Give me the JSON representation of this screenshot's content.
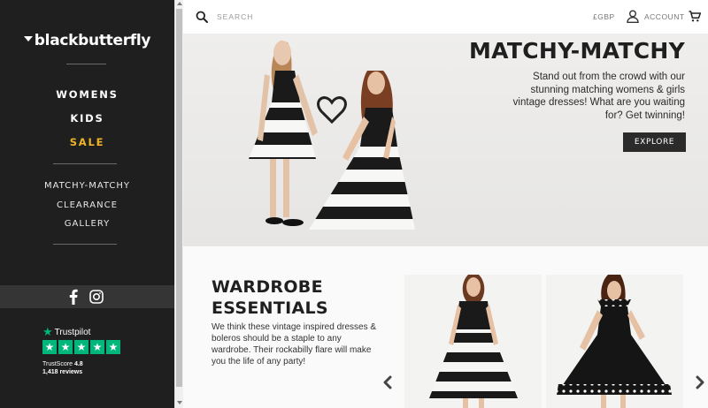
{
  "sidebar": {
    "logo": "blackbutterfly",
    "main_nav": [
      {
        "label": "WOMENS"
      },
      {
        "label": "KIDS"
      },
      {
        "label": "SALE"
      }
    ],
    "sub_nav": [
      {
        "label": "MATCHY-MATCHY"
      },
      {
        "label": "CLEARANCE"
      },
      {
        "label": "GALLERY"
      }
    ],
    "social": [
      "facebook-icon",
      "instagram-icon"
    ],
    "trustpilot": {
      "brand": "Trustpilot",
      "stars": 5,
      "score_label": "TrustScore",
      "score": "4.8",
      "reviews": "1,418 reviews"
    }
  },
  "header": {
    "search_placeholder": "SEARCH",
    "currency": "£GBP",
    "account_label": "ACCOUNT"
  },
  "hero": {
    "title": "MATCHY-MATCHY",
    "text": "Stand out from the crowd with our stunning matching womens & girls vintage dresses! What are you waiting for? Get twinning!",
    "button": "EXPLORE"
  },
  "wardrobe": {
    "title_line1": "WARDROBE",
    "title_line2": "ESSENTIALS",
    "text": "We think these vintage inspired dresses & boleros should be a staple to any wardrobe. Their rockabilly flare will make you the life of any party!"
  },
  "colors": {
    "sidebar_bg": "#1f1f1f",
    "sale_accent": "#f0b429",
    "trustpilot_green": "#00b67a",
    "button_bg": "#2b2b2b"
  }
}
